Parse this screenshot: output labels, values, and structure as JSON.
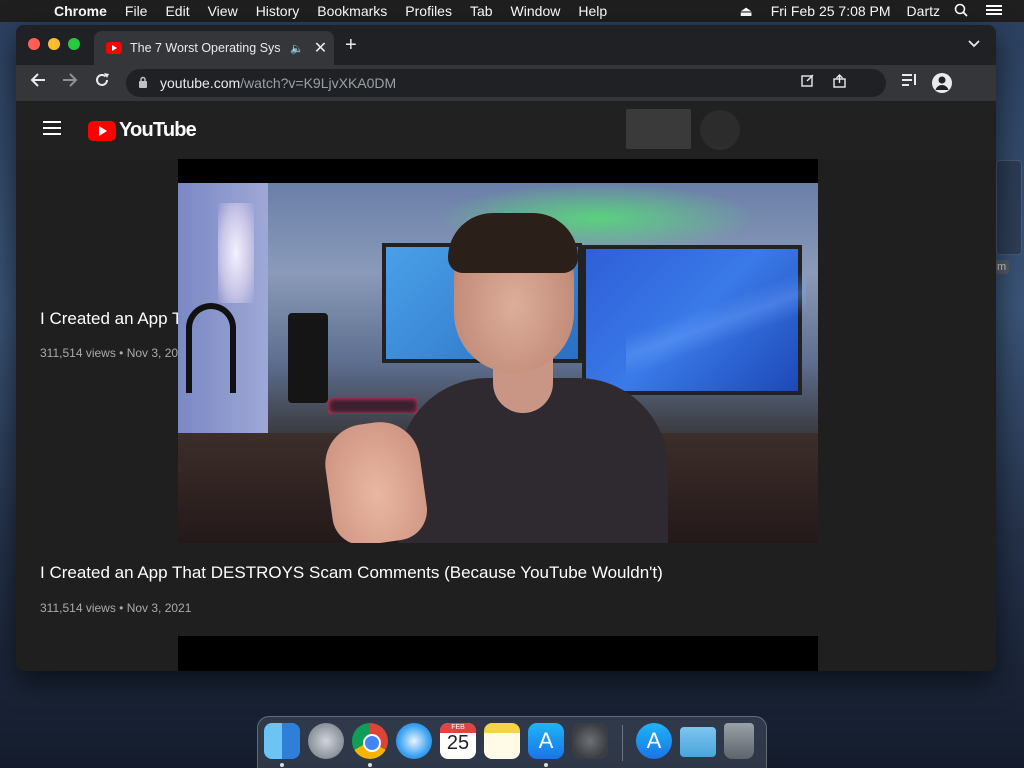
{
  "menubar": {
    "apple": "",
    "app_name": "Chrome",
    "items": [
      "File",
      "Edit",
      "View",
      "History",
      "Bookmarks",
      "Profiles",
      "Tab",
      "Window",
      "Help"
    ],
    "clock": "Fri Feb 25  7:08 PM",
    "user": "Dartz",
    "icons": [
      "eject-icon",
      "search-icon",
      "control-center-icon"
    ]
  },
  "desktop": {
    "peek_label": "m"
  },
  "browser": {
    "tab": {
      "title": "The 7 Worst Operating Sys",
      "audio_icon": "speaker-icon",
      "close": "✕"
    },
    "new_tab": "+",
    "omnibox": {
      "host": "youtube.com",
      "path": "/watch?v=K9LjvXKA0DM"
    }
  },
  "youtube": {
    "logo_text": "YouTube",
    "videos": [
      {
        "title": "I Created an App That DESTROYS Scam Comments (Because YouTube Wouldn't)",
        "meta": "311,514 views • Nov 3, 2021"
      },
      {
        "title": "I Created an App That DESTROYS Scam Comments (Because YouTube Wouldn't)",
        "meta": "311,514 views • Nov 3, 2021"
      }
    ]
  },
  "dock": {
    "calendar_day": "25",
    "calendar_month": "FEB",
    "apps": [
      "finder",
      "launchpad",
      "chrome",
      "safari",
      "calendar",
      "notes",
      "app-store",
      "system-preferences",
      "app-store-downloads",
      "downloads-folder",
      "trash"
    ]
  },
  "colors": {
    "youtube_red": "#ff0000",
    "chrome_dark": "#202124",
    "toolbar": "#35363a"
  }
}
